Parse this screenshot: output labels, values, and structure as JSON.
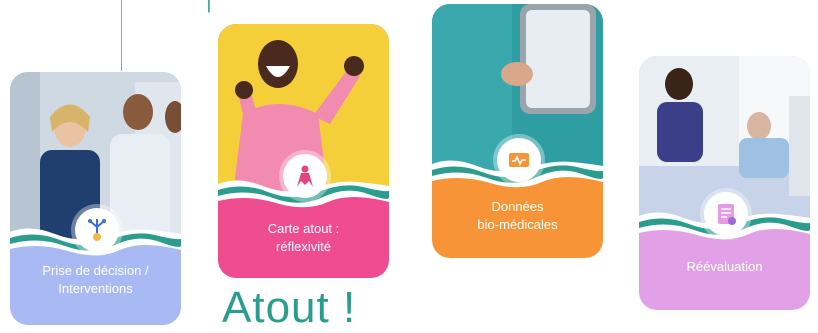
{
  "headline": "Atout !",
  "top_fragment": "|",
  "cards": [
    {
      "label_line1": "Prise de décision /",
      "label_line2": "Interventions",
      "band_color": "#a8b9f3",
      "icon": "decision-icon"
    },
    {
      "label_line1": "Carte atout :",
      "label_line2": "réflexivité",
      "band_color": "#ef4c8f",
      "icon": "superhero-icon"
    },
    {
      "label_line1": "Données",
      "label_line2": "bio-médicales",
      "band_color": "#f79437",
      "icon": "monitor-icon"
    },
    {
      "label_line1": "Réévaluation",
      "label_line2": "",
      "band_color": "#e2a1e6",
      "icon": "checklist-icon"
    }
  ],
  "colors": {
    "teal": "#2a9d8f",
    "navy": "#1f4f7a"
  }
}
